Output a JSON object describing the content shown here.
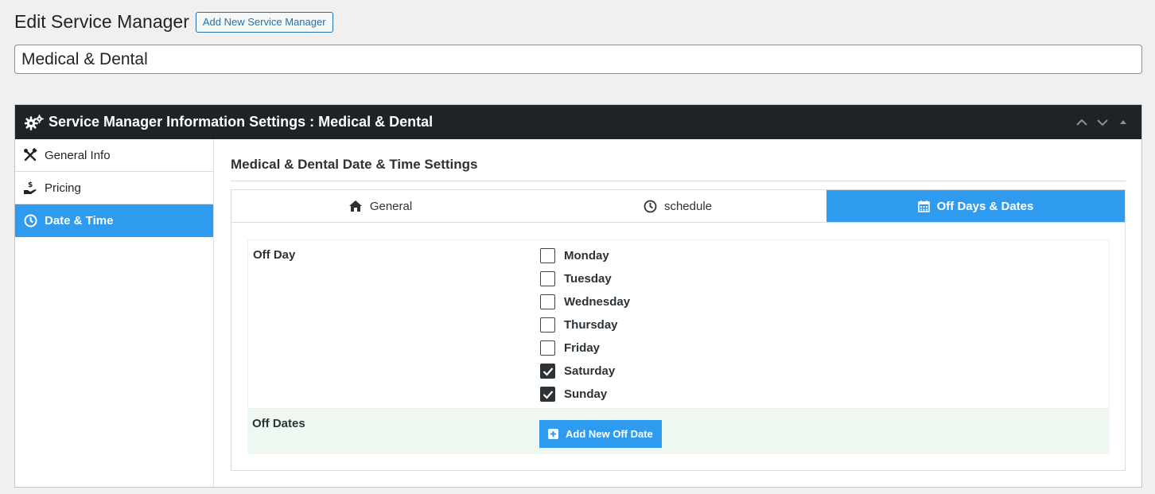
{
  "page": {
    "title": "Edit Service Manager",
    "add_new_label": "Add New Service Manager",
    "post_title": "Medical & Dental"
  },
  "panel": {
    "title": "Service Manager Information Settings : Medical & Dental",
    "controls": [
      "chevron-up-icon",
      "chevron-down-icon",
      "triangle-up-icon"
    ]
  },
  "sidebar": {
    "items": [
      {
        "label": "General Info",
        "icon": "tools-icon",
        "active": false
      },
      {
        "label": "Pricing",
        "icon": "hand-coin-icon",
        "active": false
      },
      {
        "label": "Date & Time",
        "icon": "clock-icon",
        "active": true
      }
    ]
  },
  "content": {
    "section_title": "Medical & Dental Date & Time Settings",
    "tabs": [
      {
        "label": "General",
        "icon": "home-icon",
        "active": false
      },
      {
        "label": "schedule",
        "icon": "clock-icon",
        "active": false
      },
      {
        "label": "Off Days & Dates",
        "icon": "calendar-icon",
        "active": true
      }
    ],
    "off_day_label": "Off Day",
    "days": [
      {
        "label": "Monday",
        "checked": false
      },
      {
        "label": "Tuesday",
        "checked": false
      },
      {
        "label": "Wednesday",
        "checked": false
      },
      {
        "label": "Thursday",
        "checked": false
      },
      {
        "label": "Friday",
        "checked": false
      },
      {
        "label": "Saturday",
        "checked": true
      },
      {
        "label": "Sunday",
        "checked": true
      }
    ],
    "off_dates_label": "Off Dates",
    "add_off_date_label": "Add New Off Date"
  },
  "colors": {
    "accent": "#2f9bef",
    "header_bg": "#1e2327",
    "link": "#2271b1",
    "off_dates_bg": "#eef8f0"
  }
}
